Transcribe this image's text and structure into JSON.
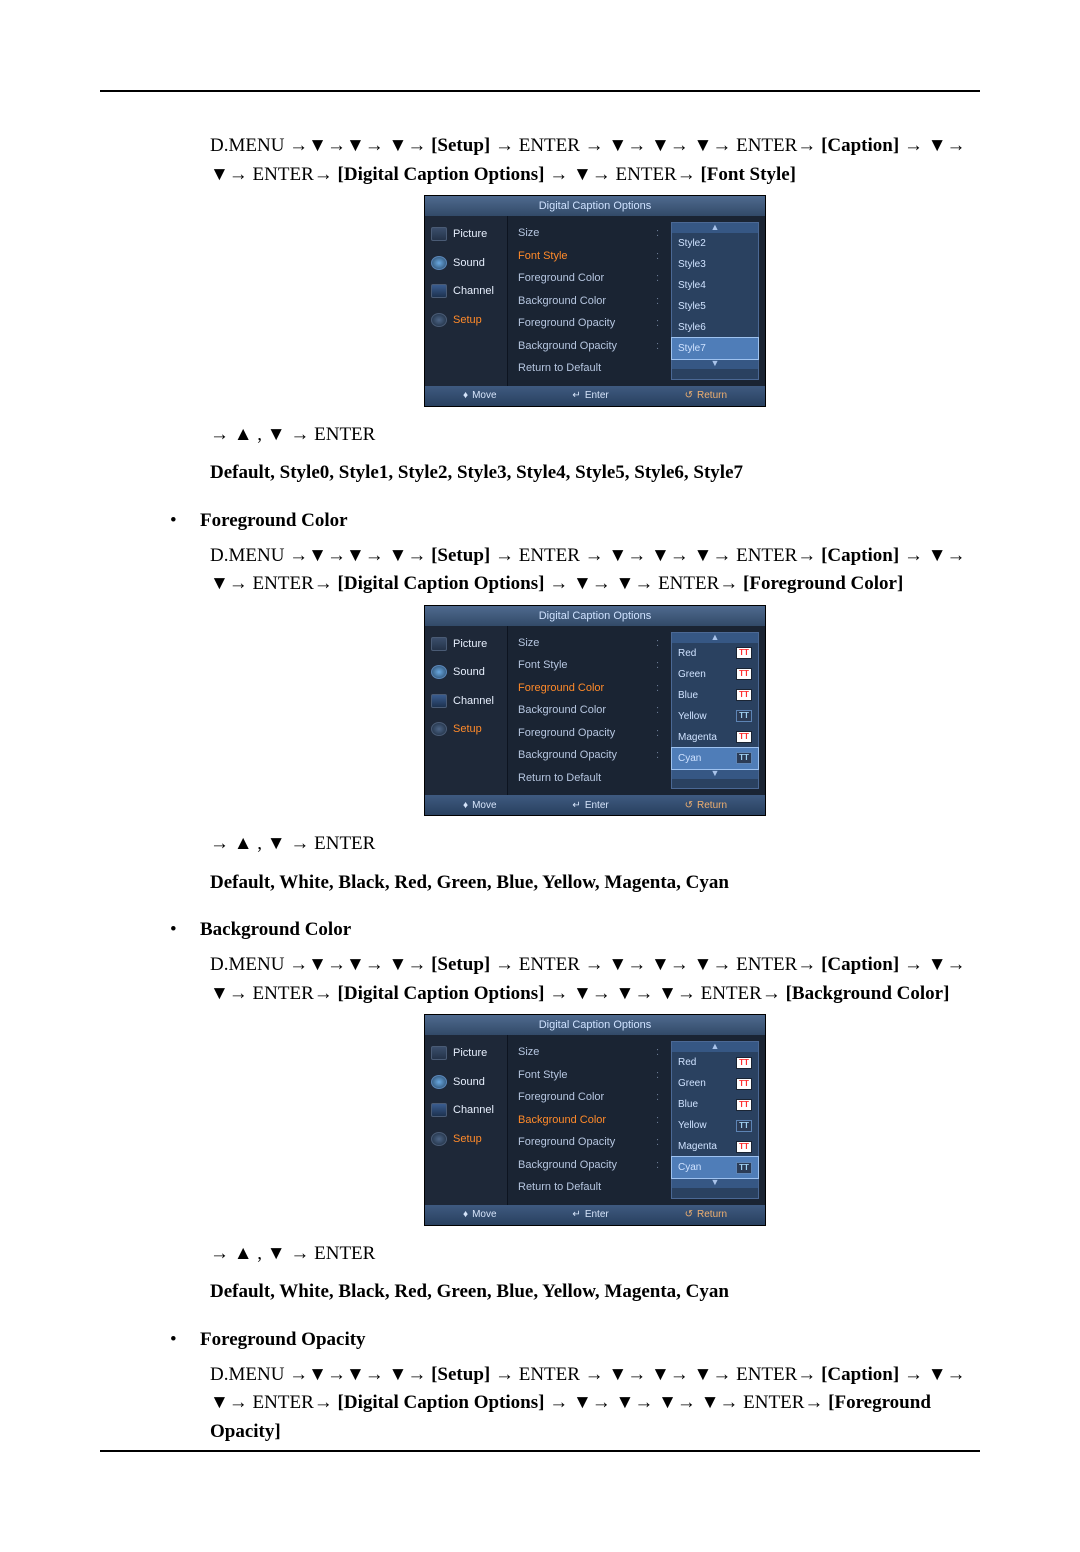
{
  "nav": {
    "prefix1": "D.MENU →▼→▼→ ▼→ ",
    "setup": "[Setup]",
    "mid1": " → ENTER → ▼→ ▼→ ▼→ ENTER→ ",
    "caption": "[Caption]",
    "mid2": " → ▼→ ▼→ ENTER→ ",
    "dco": "[Digital Caption Options]",
    "fontStylePath": " → ▼→ ENTER→ ",
    "fontStyleTarget": "[Font Style]",
    "fgColorPath": " → ▼→ ▼→ ENTER→ ",
    "fgColorTarget": "[Foreground Color]",
    "bgColorPath": " → ▼→ ▼→ ▼→ ENTER→ ",
    "bgColorTarget": "[Background Color]",
    "fgOpacityPath": " → ▼→ ▼→ ▼→ ▼→ ENTER→ ",
    "fgOpacityTarget": "[Foreground Opacity]",
    "post": "→ ▲ , ▼ → ENTER"
  },
  "values": {
    "fontStyle": "Default, Style0, Style1, Style2, Style3, Style4, Style5, Style6, Style7",
    "colors": "Default, White, Black, Red, Green, Blue, Yellow, Magenta, Cyan"
  },
  "headings": {
    "fgColor": "Foreground Color",
    "bgColor": "Background Color",
    "fgOpacity": "Foreground Opacity"
  },
  "osd": {
    "title": "Digital Caption Options",
    "side": {
      "picture": "Picture",
      "sound": "Sound",
      "channel": "Channel",
      "setup": "Setup"
    },
    "list": {
      "size": "Size",
      "fontStyle": "Font Style",
      "fgColor": "Foreground Color",
      "bgColor": "Background Color",
      "fgOpacity": "Foreground Opacity",
      "bgOpacity": "Background Opacity",
      "returnDefault": "Return to Default"
    },
    "footer": {
      "move": "Move",
      "enter": "Enter",
      "return": "Return"
    },
    "drop_style": {
      "items": [
        "Style2",
        "Style3",
        "Style4",
        "Style5",
        "Style6"
      ],
      "selected": "Style7"
    },
    "drop_color": {
      "items": [
        "Red",
        "Green",
        "Blue",
        "Yellow",
        "Magenta"
      ],
      "selected": "Cyan"
    }
  },
  "glyphs": {
    "bullet": "•",
    "updown": "♦",
    "enter": "↵",
    "return": "↺",
    "upArrow": "▲",
    "downArrow": "▼",
    "tt": "TT"
  }
}
